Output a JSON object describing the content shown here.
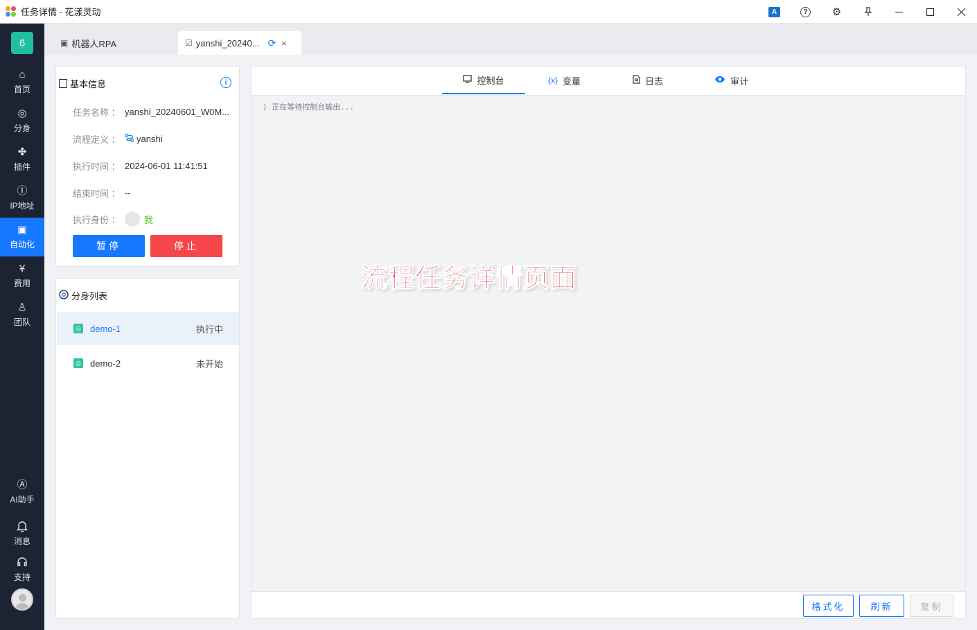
{
  "window": {
    "title": "任务详情 - 花漾灵动",
    "translate_label": "A",
    "help_label": "?",
    "settings_label": "⚙",
    "pin_label": "📌",
    "minimize_label": "—",
    "maximize_label": "☐",
    "close_label": "✕"
  },
  "sidebar": {
    "badge": "6",
    "items": [
      {
        "label": "首页",
        "icon": "home-icon",
        "glyph": "⌂"
      },
      {
        "label": "分身",
        "icon": "browser-icon",
        "glyph": "◎"
      },
      {
        "label": "插件",
        "icon": "puzzle-icon",
        "glyph": "✤"
      },
      {
        "label": "IP地址",
        "icon": "ip-icon",
        "glyph": "Ⓘ"
      },
      {
        "label": "自动化",
        "icon": "robot-icon",
        "glyph": "▣",
        "active": true
      },
      {
        "label": "费用",
        "icon": "yen-icon",
        "glyph": "¥"
      },
      {
        "label": "团队",
        "icon": "team-icon",
        "glyph": "♙"
      }
    ],
    "bottom_items": [
      {
        "label": "AI助手",
        "icon": "ai-icon",
        "glyph": "Ⓐ"
      },
      {
        "label": "消息",
        "icon": "bell-icon",
        "glyph": "♫"
      },
      {
        "label": "支持",
        "icon": "headset-icon",
        "glyph": "☊"
      }
    ]
  },
  "tabs": [
    {
      "label": "机器人RPA",
      "icon": "robot-icon",
      "glyph": "▣"
    },
    {
      "label": "yanshi_20240...",
      "icon": "task-icon",
      "glyph": "☑",
      "active": true,
      "refresh_glyph": "⟳",
      "close_glyph": "×"
    }
  ],
  "basic_info": {
    "title": "基本信息",
    "info_glyph": "i",
    "fields": [
      {
        "key": "任务名称",
        "value": "yanshi_20240601_W0M..."
      },
      {
        "key": "流程定义",
        "value": "yanshi"
      },
      {
        "key": "执行时间",
        "value": "2024-06-01 11:41:51"
      },
      {
        "key": "结束时间",
        "value": "--"
      },
      {
        "key": "执行身份",
        "value": "我"
      }
    ],
    "colon": "：",
    "pause_label": "暂停",
    "stop_label": "停止"
  },
  "clone_list": {
    "title": "分身列表",
    "items": [
      {
        "name": "demo-1",
        "status": "执行中",
        "active": true
      },
      {
        "name": "demo-2",
        "status": "未开始",
        "active": false
      }
    ]
  },
  "console": {
    "tabs": [
      {
        "label": "控制台",
        "icon": "monitor-icon",
        "glyph": "▭",
        "active": true
      },
      {
        "label": "变量",
        "icon": "variable-icon",
        "glyph": "{x}"
      },
      {
        "label": "日志",
        "icon": "document-icon",
        "glyph": "▤"
      },
      {
        "label": "审计",
        "icon": "eye-icon",
        "glyph": "◉"
      }
    ],
    "output": "正在等待控制台输出...",
    "output_prefix": "⟩",
    "format_label": "格式化",
    "refresh_label": "刷新",
    "copy_label": "复制"
  },
  "overlay_caption": "流程任务详情页面",
  "colors": {
    "accent": "#1677ff",
    "danger": "#f5464a",
    "sidebar_bg": "#1c2434",
    "success": "#52c41a",
    "clone_chip": "#2ec4a0"
  }
}
